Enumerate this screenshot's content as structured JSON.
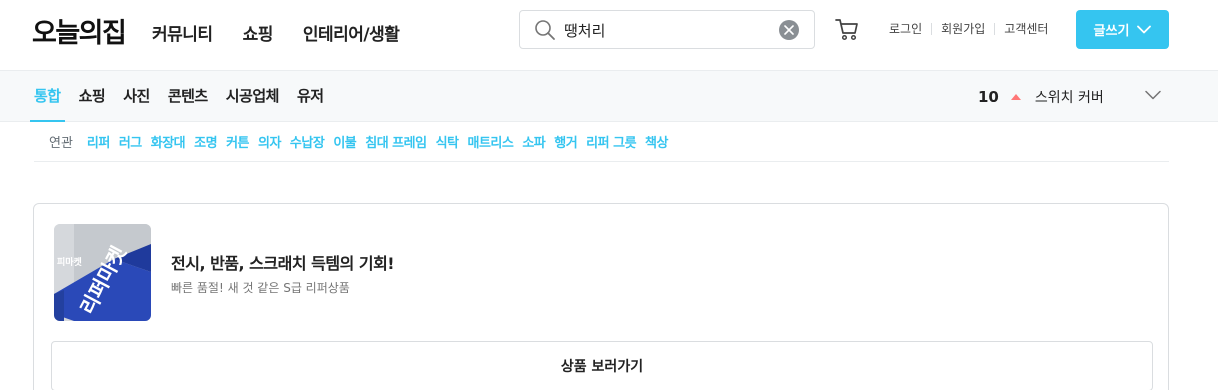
{
  "header": {
    "logo": "오늘의집",
    "nav": [
      "커뮤니티",
      "쇼핑",
      "인테리어/생활"
    ],
    "search": {
      "value": "땡처리",
      "placeholder": ""
    },
    "utility_links": [
      "로그인",
      "회원가입",
      "고객센터"
    ],
    "write_button": "글쓰기"
  },
  "subnav": {
    "tabs": [
      "통합",
      "쇼핑",
      "사진",
      "콘텐츠",
      "시공업체",
      "유저"
    ],
    "active_tab": "통합",
    "ranking": {
      "rank": "10",
      "trend": "up",
      "keyword": "스위치 커버"
    }
  },
  "related": {
    "label": "연관",
    "keywords": [
      "리퍼",
      "러그",
      "화장대",
      "조명",
      "커튼",
      "의자",
      "수납장",
      "이불",
      "침대 프레임",
      "식탁",
      "매트리스",
      "소파",
      "행거",
      "리퍼 그릇",
      "책상"
    ]
  },
  "promo": {
    "thumb_texts": [
      "리퍼마켓",
      "피마켓"
    ],
    "title": "전시, 반품, 스크래치 득템의 기회!",
    "subtitle": "빠른 품절! 새 것 같은 S급 리퍼상품",
    "button": "상품 보러가기"
  },
  "colors": {
    "accent": "#35c5f0",
    "trend_up": "#ff7777",
    "border": "#dadde0",
    "subnav_bg": "#f7f9fa",
    "thumb_blue": "#2a49b8"
  },
  "icons": [
    "search-icon",
    "clear-icon",
    "cart-icon",
    "chevron-down-icon",
    "trend-up-icon"
  ]
}
